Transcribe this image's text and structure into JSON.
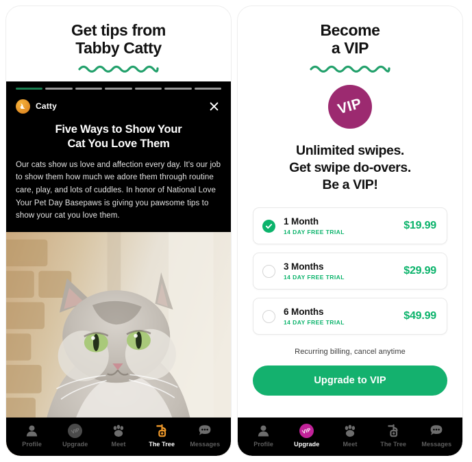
{
  "theme": {
    "accent_green": "#0bb36b",
    "cta_green": "#14b16e",
    "squiggle_green": "#22a06b",
    "vip_purple": "#9c2a70",
    "vip_nav_magenta": "#c2239a",
    "tree_orange": "#f09a2b",
    "card_black": "#000000"
  },
  "left_panel": {
    "title_line1": "Get tips from",
    "title_line2": "Tabby Catty",
    "story": {
      "progress_segments": 7,
      "active_segment": 1,
      "avatar_name": "cat-avatar",
      "handle": "Catty",
      "close_label": "Close",
      "headline_line1": "Five Ways to Show Your",
      "headline_line2": "Cat You Love Them",
      "body": "Our cats show us love and affection every day. It's our job to show them how much we adore them through routine care, play, and lots of cuddles. In honor of National Love Your Pet Day Basepaws is giving you pawsome tips to show your cat you love them."
    },
    "photo_alt": "Fluffy grey and white tabby cat sitting in front of a sandstone wall",
    "nav": {
      "active": "The Tree",
      "items": [
        {
          "label": "Profile",
          "icon": "person-icon",
          "state": "inactive"
        },
        {
          "label": "Upgrade",
          "icon": "vip-icon",
          "state": "inactive"
        },
        {
          "label": "Meet",
          "icon": "paw-icon",
          "state": "inactive"
        },
        {
          "label": "The Tree",
          "icon": "tree-icon",
          "state": "active"
        },
        {
          "label": "Messages",
          "icon": "chat-icon",
          "state": "inactive"
        }
      ]
    }
  },
  "right_panel": {
    "title_line1": "Become",
    "title_line2": "a VIP",
    "badge_text": "VIP",
    "pitch_line1": "Unlimited swipes.",
    "pitch_line2": "Get swipe do-overs.",
    "pitch_line3": "Be a VIP!",
    "plans": [
      {
        "name": "1 Month",
        "trial": "14 DAY FREE TRIAL",
        "price": "$19.99",
        "selected": true
      },
      {
        "name": "3 Months",
        "trial": "14 DAY FREE TRIAL",
        "price": "$29.99",
        "selected": false
      },
      {
        "name": "6 Months",
        "trial": "14 DAY FREE TRIAL",
        "price": "$49.99",
        "selected": false
      }
    ],
    "recurring_note": "Recurring billing, cancel anytime",
    "cta_label": "Upgrade to VIP",
    "nav": {
      "active": "Upgrade",
      "items": [
        {
          "label": "Profile",
          "icon": "person-icon",
          "state": "inactive"
        },
        {
          "label": "Upgrade",
          "icon": "vip-icon",
          "state": "active"
        },
        {
          "label": "Meet",
          "icon": "paw-icon",
          "state": "inactive"
        },
        {
          "label": "The Tree",
          "icon": "tree-icon",
          "state": "inactive"
        },
        {
          "label": "Messages",
          "icon": "chat-icon",
          "state": "inactive"
        }
      ]
    }
  }
}
